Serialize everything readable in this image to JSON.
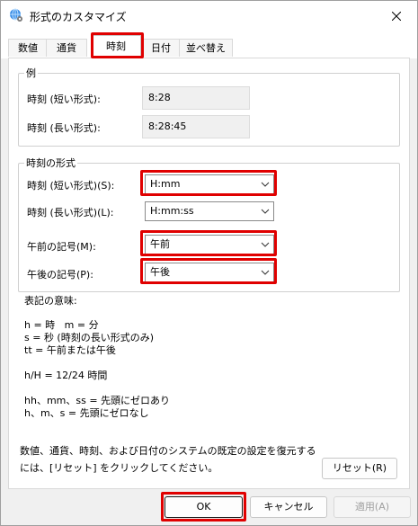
{
  "window": {
    "title": "形式のカスタマイズ",
    "icon": "globe-settings-icon",
    "close_icon": "close-icon"
  },
  "tabs": [
    {
      "label": "数値",
      "active": false
    },
    {
      "label": "通貨",
      "active": false
    },
    {
      "label": "時刻",
      "active": true
    },
    {
      "label": "日付",
      "active": false
    },
    {
      "label": "並べ替え",
      "active": false
    }
  ],
  "example_group": {
    "legend": "例",
    "short_label": "時刻 (短い形式):",
    "short_value": "8:28",
    "long_label": "時刻 (長い形式):",
    "long_value": "8:28:45"
  },
  "format_group": {
    "legend": "時刻の形式",
    "short_label": "時刻 (短い形式)(S):",
    "short_value": "H:mm",
    "long_label": "時刻 (長い形式)(L):",
    "long_value": "H:mm:ss",
    "am_label": "午前の記号(M):",
    "am_value": "午前",
    "pm_label": "午後の記号(P):",
    "pm_value": "午後"
  },
  "notation": {
    "heading": "表記の意味:",
    "lines": [
      "h = 時   m = 分",
      "s = 秒 (時刻の長い形式のみ)",
      "tt = 午前または午後",
      "h/H = 12/24 時間",
      "hh、mm、ss = 先頭にゼロあり",
      "h、m、s = 先頭にゼロなし"
    ]
  },
  "reset": {
    "text_line1": "数値、通貨、時刻、および日付のシステムの既定の設定を復元する",
    "text_line2": "には、[リセット] をクリックしてください。",
    "button": "リセット(R)"
  },
  "footer": {
    "ok": "OK",
    "cancel": "キャンセル",
    "apply": "適用(A)"
  },
  "colors": {
    "highlight": "#e00000"
  }
}
